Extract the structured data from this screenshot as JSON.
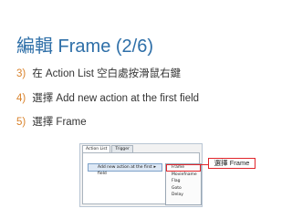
{
  "slide": {
    "title": "編輯 Frame (2/6)",
    "steps": [
      {
        "num": "3)",
        "text": "在 Action List 空白處按滑鼠右鍵"
      },
      {
        "num": "4)",
        "text": "選擇 Add new action at the first field"
      },
      {
        "num": "5)",
        "text": "選擇 Frame"
      }
    ]
  },
  "screenshot": {
    "tabs": [
      "Action List",
      "Trigger"
    ],
    "context_menu_item": "Add new action at the first field",
    "submenu_arrow": "▸",
    "submenu_items": [
      "Frame",
      "Moviefname",
      "Flag",
      "Goto",
      "Delay"
    ]
  },
  "callout": {
    "text": "選擇 Frame"
  },
  "colors": {
    "title": "#2e6fa8",
    "step_number": "#d9822b",
    "highlight": "#e0252b"
  }
}
